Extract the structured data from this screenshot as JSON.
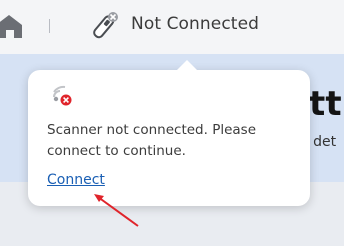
{
  "header": {
    "connection_status": "Not Connected",
    "icons": [
      "home-icon",
      "scanner-disconnected-icon"
    ]
  },
  "background": {
    "heading_partial": "ett",
    "subtext_partial": "c det"
  },
  "popover": {
    "icon": "wifi-error-icon",
    "message": "Scanner not connected. Please connect to continue.",
    "link_label": "Connect"
  },
  "colors": {
    "link": "#1a5fb4",
    "error": "#e0242b",
    "annotation_arrow": "#e0242b",
    "band": "#d6e2f4"
  }
}
